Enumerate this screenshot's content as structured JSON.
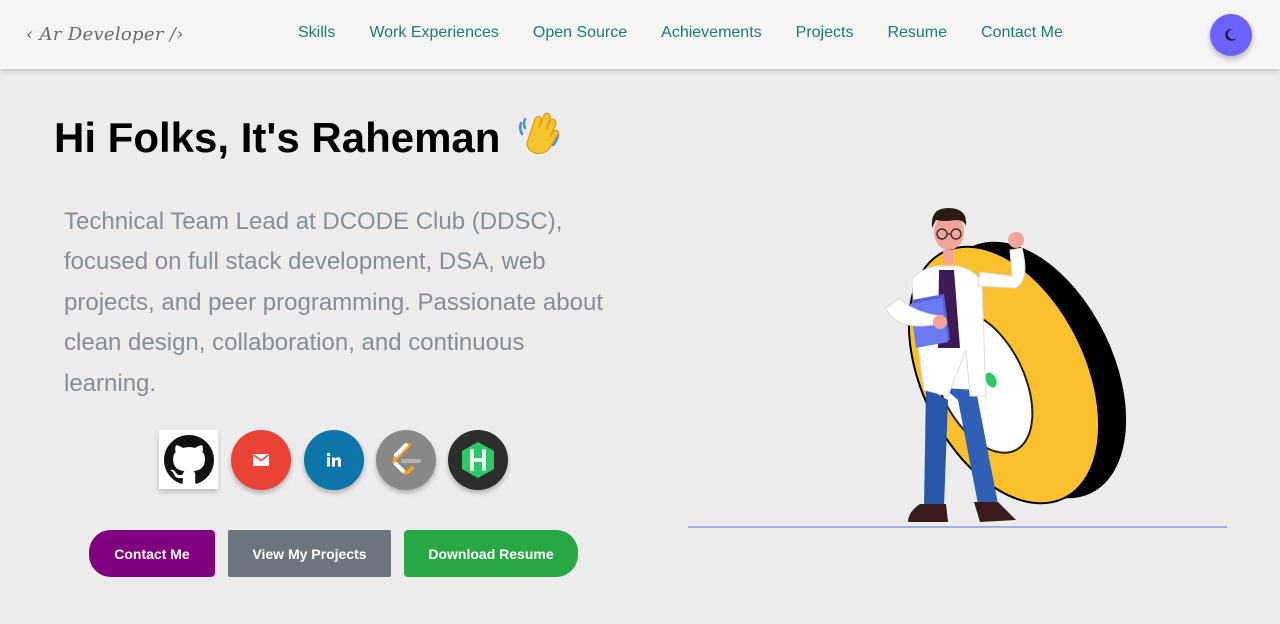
{
  "nav": {
    "logo": "‹ Ar Developer /›",
    "links": [
      "Skills",
      "Work Experiences",
      "Open Source",
      "Achievements",
      "Projects",
      "Resume",
      "Contact Me"
    ],
    "theme_toggle_icon": "moon-icon",
    "theme_toggle_color": "#6c63ff"
  },
  "hero": {
    "greeting": "Hi Folks, It's Raheman",
    "greeting_emoji_icon": "waving-hand-icon",
    "bio": "Technical Team Lead at DCODE Club (DDSC), focused on full stack development, DSA, web projects, and peer programming. Passionate about clean design, collaboration, and continuous learning.",
    "social_icons": [
      {
        "name": "github-icon",
        "color": "#ffffff"
      },
      {
        "name": "gmail-icon",
        "color": "#ea4335"
      },
      {
        "name": "linkedin-icon",
        "label": "in",
        "color": "#0e76a8"
      },
      {
        "name": "leetcode-icon",
        "color": "#888888"
      },
      {
        "name": "hackerrank-icon",
        "label": "H",
        "color": "#2d2d2d"
      }
    ],
    "buttons": {
      "contact": "Contact Me",
      "projects": "View My Projects",
      "resume": "Download Resume"
    },
    "button_colors": {
      "contact": "#800080",
      "projects": "#6c757d",
      "resume": "#28a745"
    },
    "illustration_icon": "developer-illustration"
  }
}
